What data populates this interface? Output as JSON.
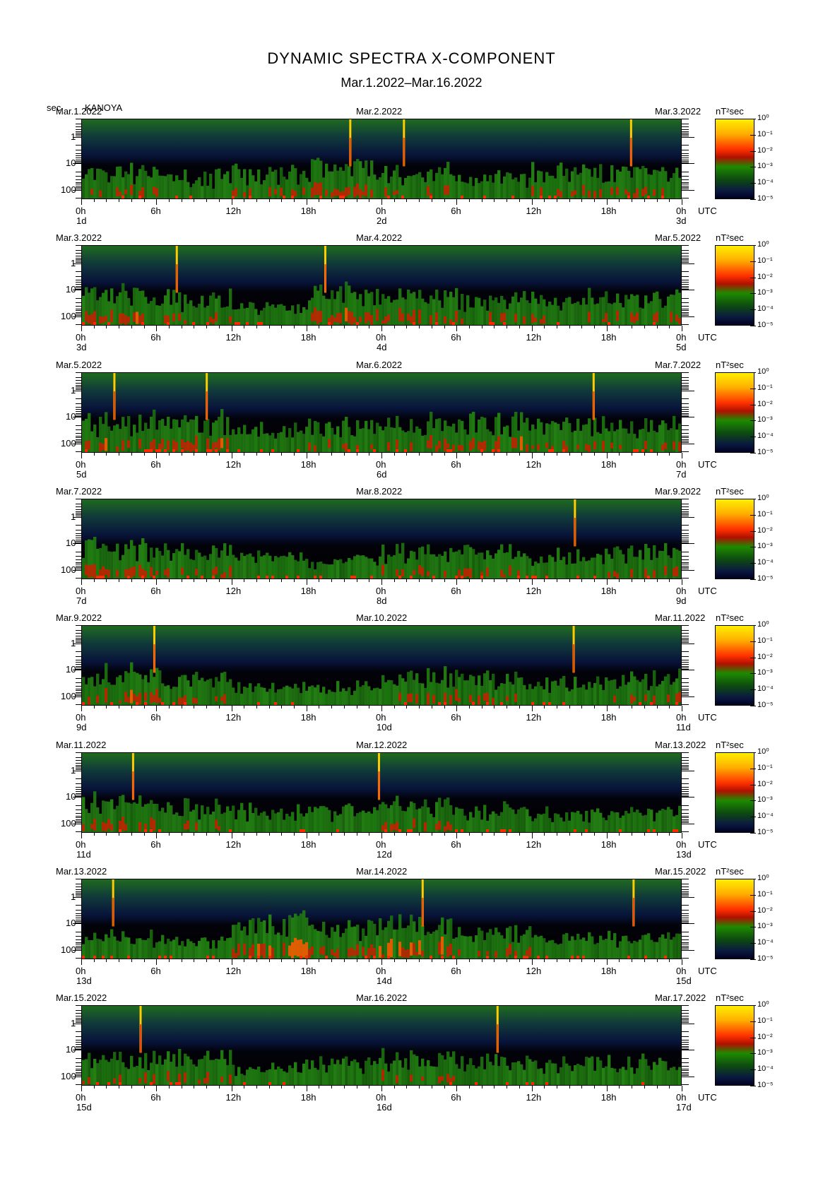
{
  "title": "DYNAMIC SPECTRA X-COMPONENT",
  "subtitle": "Mar.1.2022–Mar.16.2022",
  "y_unit": "sec",
  "station": "KANOYA",
  "colorbar_unit": "nT²sec",
  "colorbar_labels": [
    "10⁰",
    "10⁻¹",
    "10⁻²",
    "10⁻³",
    "10⁻⁴",
    "10⁻⁵"
  ],
  "y_tick_labels": [
    "1",
    "10",
    "100"
  ],
  "x_tick_labels": [
    "0h",
    "6h",
    "12h",
    "18h",
    "0h",
    "6h",
    "12h",
    "18h",
    "0h"
  ],
  "utc_label": "UTC",
  "colors": {
    "background": "#000000",
    "low": "#0a1a40",
    "mid": "#1e8a00",
    "high": "#ff3000",
    "peak": "#ffee00"
  },
  "chart_data": {
    "type": "heatmap",
    "x_unit": "hours UTC",
    "y_unit": "sec",
    "y_range": [
      0.2,
      200
    ],
    "y_scale": "log",
    "color_range": [
      1e-05,
      1
    ],
    "color_scale": "log",
    "panels": [
      {
        "start_date": "Mar.1.2022",
        "mid_date": "Mar.2.2022",
        "end_date": "Mar.3.2022",
        "start_day": "1d",
        "mid_day": "2d",
        "end_day": "3d",
        "spikes_hours": [
          21.5,
          25.8,
          44.0
        ],
        "activity": [
          0.5,
          0.4,
          0.5,
          0.6,
          0.5,
          0.4,
          0.5,
          0.5
        ]
      },
      {
        "start_date": "Mar.3.2022",
        "mid_date": "Mar.4.2022",
        "end_date": "Mar.5.2022",
        "start_day": "3d",
        "mid_day": "4d",
        "end_day": "5d",
        "spikes_hours": [
          7.6,
          19.5
        ],
        "activity": [
          0.6,
          0.5,
          0.3,
          0.6,
          0.6,
          0.5,
          0.5,
          0.5
        ]
      },
      {
        "start_date": "Mar.5.2022",
        "mid_date": "Mar.6.2022",
        "end_date": "Mar.7.2022",
        "start_day": "5d",
        "mid_day": "6d",
        "end_day": "7d",
        "spikes_hours": [
          2.6,
          10.0,
          41.0
        ],
        "activity": [
          0.6,
          0.6,
          0.4,
          0.5,
          0.6,
          0.6,
          0.5,
          0.5
        ]
      },
      {
        "start_date": "Mar.7.2022",
        "mid_date": "Mar.8.2022",
        "end_date": "Mar.9.2022",
        "start_day": "7d",
        "mid_day": "8d",
        "end_day": "9d",
        "spikes_hours": [
          39.5
        ],
        "activity": [
          0.6,
          0.5,
          0.4,
          0.3,
          0.5,
          0.5,
          0.4,
          0.5
        ]
      },
      {
        "start_date": "Mar.9.2022",
        "mid_date": "Mar.10.2022",
        "end_date": "Mar.11.2022",
        "start_day": "9d",
        "mid_day": "10d",
        "end_day": "11d",
        "spikes_hours": [
          5.8,
          39.4
        ],
        "activity": [
          0.6,
          0.5,
          0.3,
          0.3,
          0.6,
          0.5,
          0.4,
          0.5
        ]
      },
      {
        "start_date": "Mar.11.2022",
        "mid_date": "Mar.12.2022",
        "end_date": "Mar.13.2022",
        "start_day": "11d",
        "mid_day": "12d",
        "end_day": "13d",
        "spikes_hours": [
          4.1,
          23.8
        ],
        "activity": [
          0.6,
          0.5,
          0.4,
          0.4,
          0.5,
          0.4,
          0.3,
          0.4
        ]
      },
      {
        "start_date": "Mar.13.2022",
        "mid_date": "Mar.14.2022",
        "end_date": "Mar.15.2022",
        "start_day": "13d",
        "mid_day": "14d",
        "end_day": "15d",
        "spikes_hours": [
          2.5,
          27.3,
          44.2
        ],
        "activity": [
          0.4,
          0.3,
          0.7,
          0.6,
          0.7,
          0.5,
          0.4,
          0.4
        ]
      },
      {
        "start_date": "Mar.15.2022",
        "mid_date": "Mar.16.2022",
        "end_date": "Mar.17.2022",
        "start_day": "15d",
        "mid_day": "16d",
        "end_day": "17d",
        "spikes_hours": [
          4.7,
          33.3
        ],
        "activity": [
          0.5,
          0.5,
          0.3,
          0.4,
          0.5,
          0.4,
          0.4,
          0.4
        ]
      }
    ]
  }
}
